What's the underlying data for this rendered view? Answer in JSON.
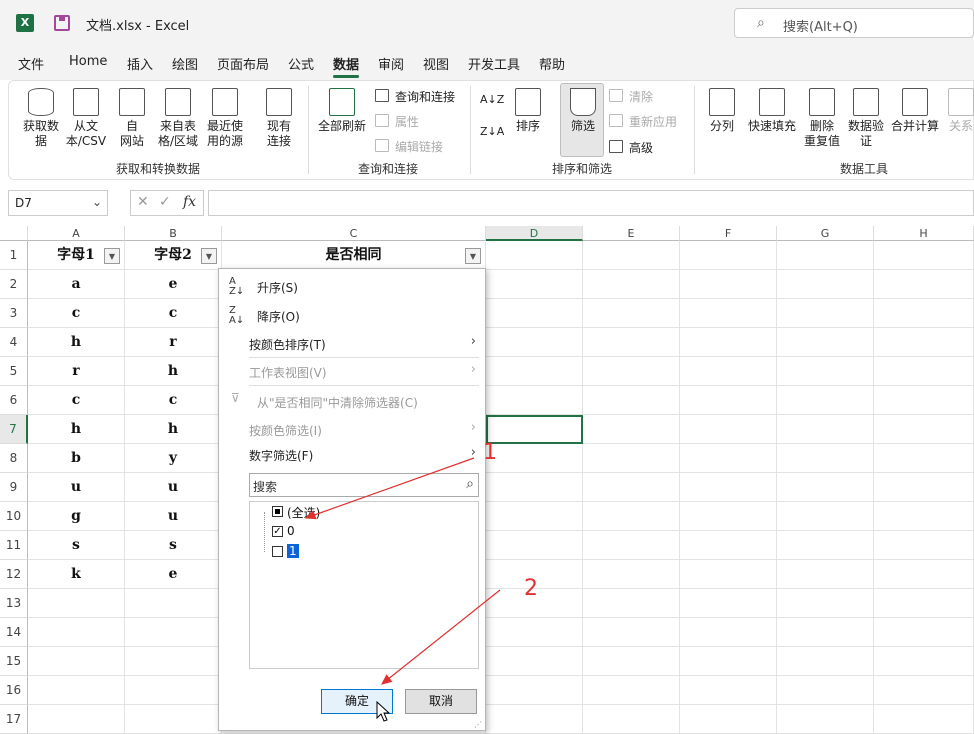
{
  "titlebar": {
    "app_icon": "X",
    "title": "文档.xlsx  -  Excel",
    "search": "搜索(Alt+Q)"
  },
  "tabs": [
    "文件",
    "Home",
    "插入",
    "绘图",
    "页面布局",
    "公式",
    "数据",
    "审阅",
    "视图",
    "开发工具",
    "帮助"
  ],
  "ribbon": {
    "get_data": "获取数\n据",
    "from_text": "从文\n本/CSV",
    "from_web": "自\n网站",
    "from_table": "来自表\n格/区域",
    "recent": "最近使\n用的源",
    "existing": "现有\n连接",
    "group1": "获取和转换数据",
    "refresh_all": "全部刷新",
    "queries": "查询和连接",
    "properties": "属性",
    "edit_links": "编辑链接",
    "group2": "查询和连接",
    "sort": "排序",
    "filter": "筛选",
    "clear": "清除",
    "reapply": "重新应用",
    "advanced": "高级",
    "group3": "排序和筛选",
    "split": "分列",
    "flash_fill": "快速填充",
    "remove_dup": "删除\n重复值",
    "validation": "数据验\n证",
    "consolidate": "合并计算",
    "relationships": "关系",
    "group4": "数据工具"
  },
  "formula_bar": {
    "name_box": "D7",
    "fx": "fx",
    "formula": ""
  },
  "columns": [
    "A",
    "B",
    "C",
    "D",
    "E",
    "F",
    "G",
    "H"
  ],
  "rows": [
    "1",
    "2",
    "3",
    "4",
    "5",
    "6",
    "7",
    "8",
    "9",
    "10",
    "11",
    "12",
    "13",
    "14",
    "15",
    "16",
    "17"
  ],
  "header_row": {
    "a": "字母1",
    "b": "字母2",
    "c": "是否相同"
  },
  "col_a": [
    "a",
    "c",
    "h",
    "r",
    "c",
    "h",
    "b",
    "u",
    "g",
    "s",
    "k"
  ],
  "col_b": [
    "e",
    "c",
    "r",
    "h",
    "c",
    "h",
    "y",
    "u",
    "u",
    "s",
    "e"
  ],
  "popup": {
    "sort_asc": "升序(S)",
    "sort_desc": "降序(O)",
    "sort_color": "按颜色排序(T)",
    "sheet_view": "工作表视图(V)",
    "clear_filter": "从\"是否相同\"中清除筛选器(C)",
    "filter_color": "按颜色筛选(I)",
    "number_filter": "数字筛选(F)",
    "search_placeholder": "搜索",
    "items": [
      {
        "label": "(全选)",
        "state": "partial"
      },
      {
        "label": "0",
        "state": "checked"
      },
      {
        "label": "1",
        "state": "unchecked"
      }
    ],
    "ok": "确定",
    "cancel": "取消"
  },
  "annotations": {
    "one": "1",
    "two": "2"
  },
  "colors": {
    "accent": "#217346",
    "annotation": "#e03030"
  }
}
